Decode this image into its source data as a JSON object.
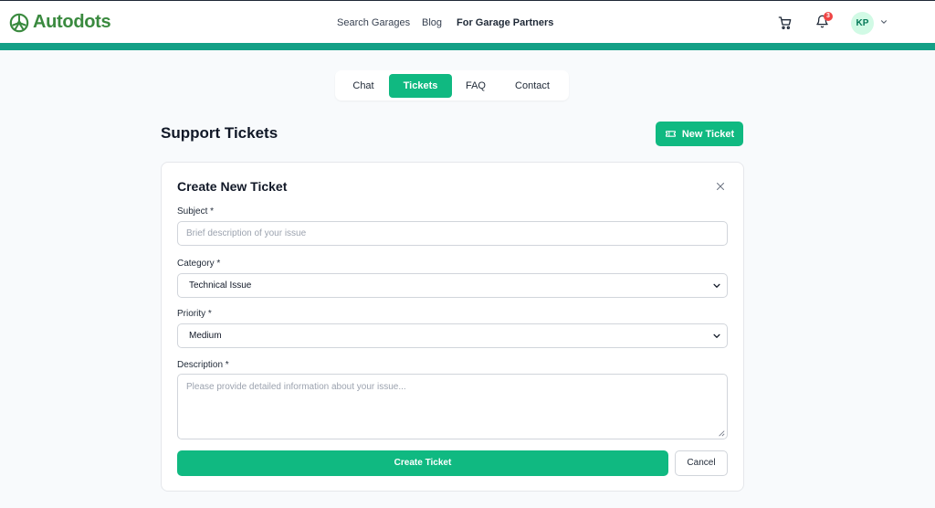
{
  "app": {
    "logo_text": "Autodots",
    "brand_color": "#3a8a3f",
    "accent_color": "#10b981"
  },
  "header": {
    "nav": [
      "Search Garages",
      "Blog",
      "For Garage Partners"
    ],
    "notification_count": "3",
    "avatar_initials": "KP",
    "icons": [
      "cart-icon",
      "bell-icon",
      "chevron-down-icon"
    ]
  },
  "tabs": [
    {
      "label": "Chat",
      "active": false
    },
    {
      "label": "Tickets",
      "active": true
    },
    {
      "label": "FAQ",
      "active": false
    },
    {
      "label": "Contact",
      "active": false
    }
  ],
  "page": {
    "title": "Support Tickets",
    "new_ticket_label": "New Ticket"
  },
  "form": {
    "title": "Create New Ticket",
    "subject": {
      "label": "Subject *",
      "placeholder": "Brief description of your issue"
    },
    "category": {
      "label": "Category *",
      "value": "Technical Issue"
    },
    "priority": {
      "label": "Priority *",
      "value": "Medium"
    },
    "description": {
      "label": "Description *",
      "placeholder": "Please provide detailed information about your issue..."
    },
    "submit_label": "Create Ticket",
    "cancel_label": "Cancel"
  }
}
